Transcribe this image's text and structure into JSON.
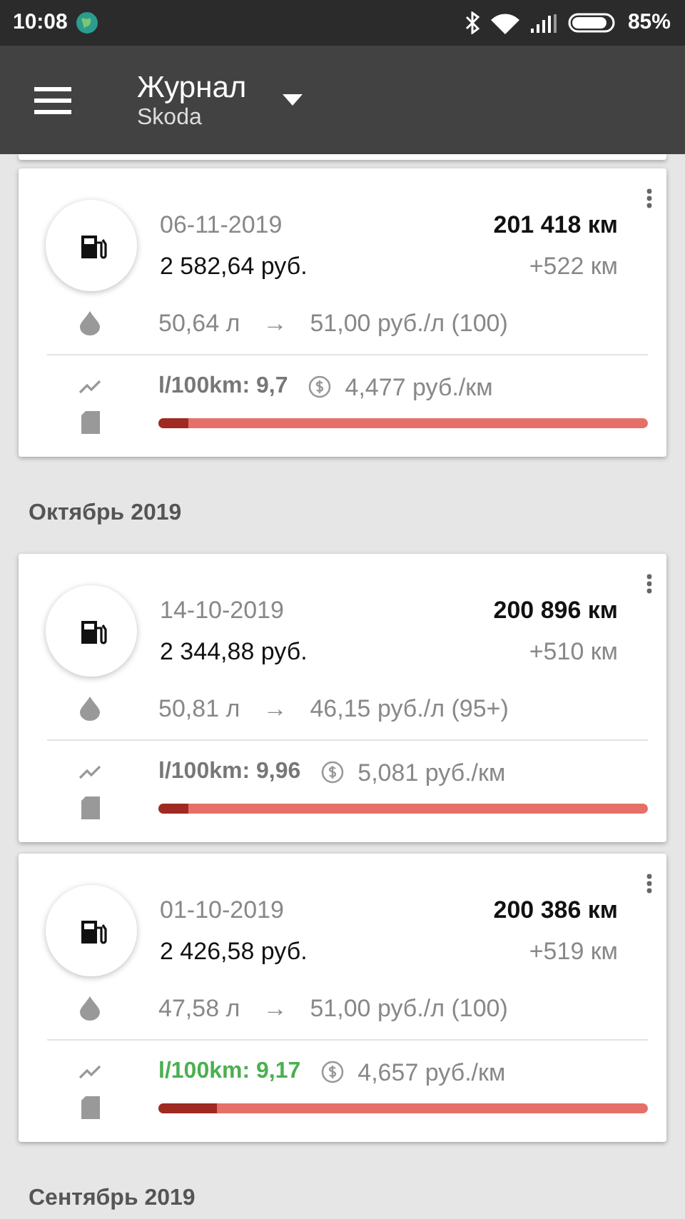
{
  "status_bar": {
    "time": "10:08",
    "battery": "85%"
  },
  "app_bar": {
    "title": "Журнал",
    "subtitle": "Skoda"
  },
  "feed": [
    {
      "kind": "entry",
      "date": "06-11-2019",
      "cost": "2 582,64 руб.",
      "odometer": "201 418 км",
      "distance": "+522 км",
      "volume": "50,64 л",
      "arrow": "→",
      "price": "51,00 руб./л (100)",
      "consumption": "l/100km: 9,7",
      "good": false,
      "cost_per_km": "4,477 руб./км",
      "level": 0.06
    },
    {
      "kind": "month",
      "label": "Октябрь 2019"
    },
    {
      "kind": "entry",
      "date": "14-10-2019",
      "cost": "2 344,88 руб.",
      "odometer": "200 896 км",
      "distance": "+510 км",
      "volume": "50,81 л",
      "arrow": "→",
      "price": "46,15 руб./л (95+)",
      "consumption": "l/100km: 9,96",
      "good": false,
      "cost_per_km": "5,081 руб./км",
      "level": 0.06
    },
    {
      "kind": "entry",
      "date": "01-10-2019",
      "cost": "2 426,58 руб.",
      "odometer": "200 386 км",
      "distance": "+519 км",
      "volume": "47,58 л",
      "arrow": "→",
      "price": "51,00 руб./л (100)",
      "consumption": "l/100km: 9,17",
      "good": true,
      "cost_per_km": "4,657 руб./км",
      "level": 0.12
    },
    {
      "kind": "month",
      "label": "Сентябрь 2019"
    }
  ]
}
